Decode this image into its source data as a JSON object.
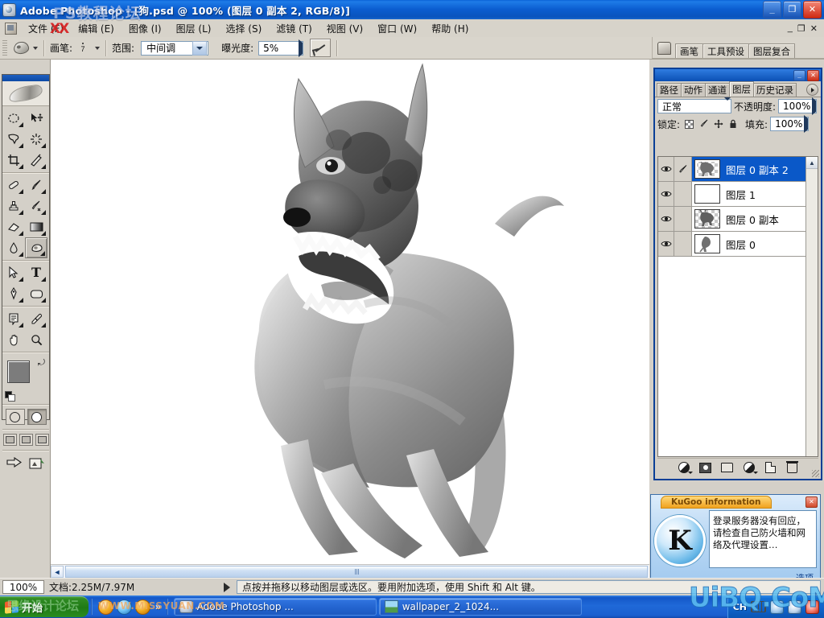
{
  "window": {
    "title": "Adobe Photoshop - [狗.psd @ 100% (图层 0 副本 2, RGB/8)]",
    "minimize_label": "_",
    "restore_label": "❐",
    "close_label": "✕",
    "doc_minimize_label": "_",
    "doc_restore_label": "❐",
    "doc_close_label": "✕"
  },
  "menubar": {
    "items": [
      {
        "label": "文件 (F)"
      },
      {
        "label": "编辑 (E)"
      },
      {
        "label": "图像 (I)"
      },
      {
        "label": "图层 (L)"
      },
      {
        "label": "选择 (S)"
      },
      {
        "label": "滤镜 (T)"
      },
      {
        "label": "视图 (V)"
      },
      {
        "label": "窗口 (W)"
      },
      {
        "label": "帮助 (H)"
      }
    ]
  },
  "options_bar": {
    "brush_label": "画笔:",
    "brush_size": "7",
    "range_label": "范围:",
    "range_value": "中间调",
    "exposure_label": "曝光度:",
    "exposure_value": "5%"
  },
  "palette_well": {
    "tabs": [
      "画笔",
      "工具预设",
      "图层复合"
    ]
  },
  "toolbox": {
    "tools": [
      {
        "name": "marquee-tool",
        "selected": false
      },
      {
        "name": "move-tool",
        "selected": false
      },
      {
        "name": "lasso-tool",
        "selected": false
      },
      {
        "name": "magic-wand-tool",
        "selected": false
      },
      {
        "name": "crop-tool",
        "selected": false
      },
      {
        "name": "slice-tool",
        "selected": false
      },
      {
        "name": "healing-brush-tool",
        "selected": false
      },
      {
        "name": "brush-tool",
        "selected": false
      },
      {
        "name": "clone-stamp-tool",
        "selected": false
      },
      {
        "name": "history-brush-tool",
        "selected": false
      },
      {
        "name": "eraser-tool",
        "selected": false
      },
      {
        "name": "gradient-tool",
        "selected": false
      },
      {
        "name": "blur-tool",
        "selected": false
      },
      {
        "name": "dodge-burn-tool",
        "selected": true
      },
      {
        "name": "path-selection-tool",
        "selected": false
      },
      {
        "name": "type-tool",
        "selected": false
      },
      {
        "name": "pen-tool",
        "selected": false
      },
      {
        "name": "shape-tool",
        "selected": false
      },
      {
        "name": "notes-tool",
        "selected": false
      },
      {
        "name": "eyedropper-tool",
        "selected": false
      },
      {
        "name": "hand-tool",
        "selected": false
      },
      {
        "name": "zoom-tool",
        "selected": false
      }
    ],
    "foreground_color": "#7c7c7c",
    "background_color": "#ffffff",
    "type_glyph": "T"
  },
  "layers_palette": {
    "tabs": [
      {
        "label": "路径",
        "active": false
      },
      {
        "label": "动作",
        "active": false
      },
      {
        "label": "通道",
        "active": false
      },
      {
        "label": "图层",
        "active": true
      },
      {
        "label": "历史记录",
        "active": false
      }
    ],
    "blend_mode": "正常",
    "opacity_label": "不透明度:",
    "opacity_value": "100%",
    "lock_label": "锁定:",
    "fill_label": "填充:",
    "fill_value": "100%",
    "layers": [
      {
        "name": "图层 0 副本 2",
        "visible": true,
        "selected": true,
        "linked_pen": true,
        "thumb": "dog"
      },
      {
        "name": "图层 1",
        "visible": true,
        "selected": false,
        "linked_pen": false,
        "thumb": "white"
      },
      {
        "name": "图层 0 副本",
        "visible": true,
        "selected": false,
        "linked_pen": false,
        "thumb": "dog"
      },
      {
        "name": "图层 0",
        "visible": true,
        "selected": false,
        "linked_pen": false,
        "thumb": "dog2"
      }
    ],
    "bottom_buttons": [
      {
        "name": "layer-style-button"
      },
      {
        "name": "add-layer-mask-button"
      },
      {
        "name": "new-group-button"
      },
      {
        "name": "new-adjustment-layer-button"
      },
      {
        "name": "new-layer-button"
      },
      {
        "name": "delete-layer-button"
      }
    ]
  },
  "kugoo_popup": {
    "title": "KuGoo information",
    "close_label": "✕",
    "logo_letter": "K",
    "message": "登录服务器没有回应，请检查自己防火墙和网络及代理设置…",
    "option_link": "选项"
  },
  "statusbar": {
    "zoom": "100%",
    "doc_info": "文档:2.25M/7.97M",
    "hint": "点按并拖移以移动图层或选区。要用附加选项，使用 Shift 和 Alt 键。"
  },
  "taskbar": {
    "start_label": "开始",
    "quick_launch_more": "»",
    "buttons": [
      {
        "label": "Adobe Photoshop ...",
        "icon": "photoshop-icon"
      },
      {
        "label": "wallpaper_2_1024...",
        "icon": "image-icon"
      }
    ],
    "tray": {
      "language": "CH"
    }
  },
  "watermarks": {
    "ps_forum": "PS教程论坛",
    "xx": "XX",
    "missyuan_site": "WWW.MISSYUAN.COM",
    "missyuan_logo": "思缘设计论坛",
    "uibq": "UiBQ.CoM"
  }
}
